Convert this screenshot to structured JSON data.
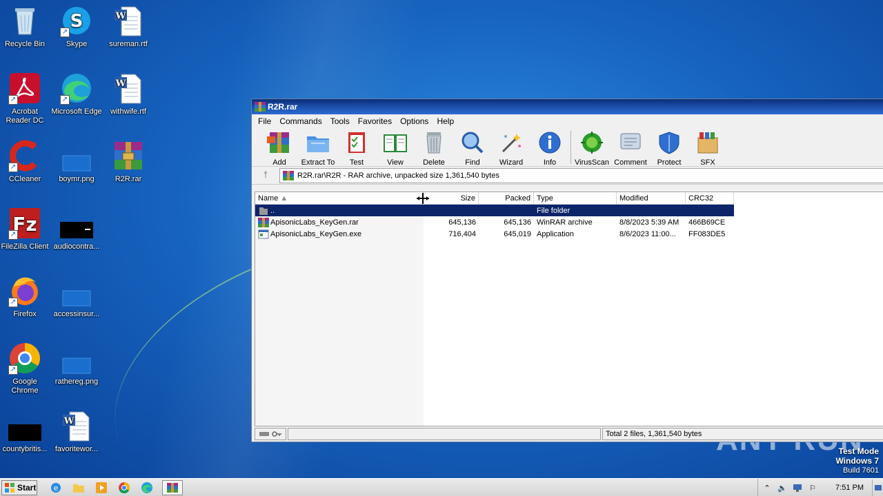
{
  "desktop": {
    "icons": [
      {
        "label": "Recycle Bin"
      },
      {
        "label": "Skype"
      },
      {
        "label": "sureman.rtf"
      },
      {
        "label": "Acrobat Reader DC"
      },
      {
        "label": "Microsoft Edge"
      },
      {
        "label": "withwife.rtf"
      },
      {
        "label": "CCleaner"
      },
      {
        "label": "boymr.png"
      },
      {
        "label": "R2R.rar"
      },
      {
        "label": "FileZilla Client"
      },
      {
        "label": "audiocontra..."
      },
      {
        "label": "Firefox"
      },
      {
        "label": "accessinsur..."
      },
      {
        "label": "Google Chrome"
      },
      {
        "label": "rathereg.png"
      },
      {
        "label": "countybritis..."
      },
      {
        "label": "favoritewor..."
      }
    ]
  },
  "window": {
    "title": "R2R.rar",
    "menu": [
      "File",
      "Commands",
      "Tools",
      "Favorites",
      "Options",
      "Help"
    ],
    "toolbar": [
      "Add",
      "Extract To",
      "Test",
      "View",
      "Delete",
      "Find",
      "Wizard",
      "Info",
      "VirusScan",
      "Comment",
      "Protect",
      "SFX"
    ],
    "address": "R2R.rar\\R2R - RAR archive, unpacked size 1,361,540 bytes",
    "columns": [
      "Name",
      "Size",
      "Packed",
      "Type",
      "Modified",
      "CRC32"
    ],
    "rows": [
      {
        "name": "..",
        "size": "",
        "packed": "",
        "type": "File folder",
        "modified": "",
        "crc": ""
      },
      {
        "name": "ApisonicLabs_KeyGen.rar",
        "size": "645,136",
        "packed": "645,136",
        "type": "WinRAR archive",
        "modified": "8/8/2023 5:39 AM",
        "crc": "466B69CE"
      },
      {
        "name": "ApisonicLabs_KeyGen.exe",
        "size": "716,404",
        "packed": "645,019",
        "type": "Application",
        "modified": "8/6/2023 11:00...",
        "crc": "FF083DE5"
      }
    ],
    "status": "Total 2 files, 1,361,540 bytes"
  },
  "taskbar": {
    "start": "Start",
    "clock": "7:51 PM"
  },
  "overlay": {
    "testmode_line1": "Test Mode",
    "testmode_line2": "Windows 7",
    "testmode_line3": "Build 7601",
    "watermark": "ANY RUN"
  },
  "colors": {
    "selection": "#0c2468",
    "titlebar": "#1e55b4"
  }
}
